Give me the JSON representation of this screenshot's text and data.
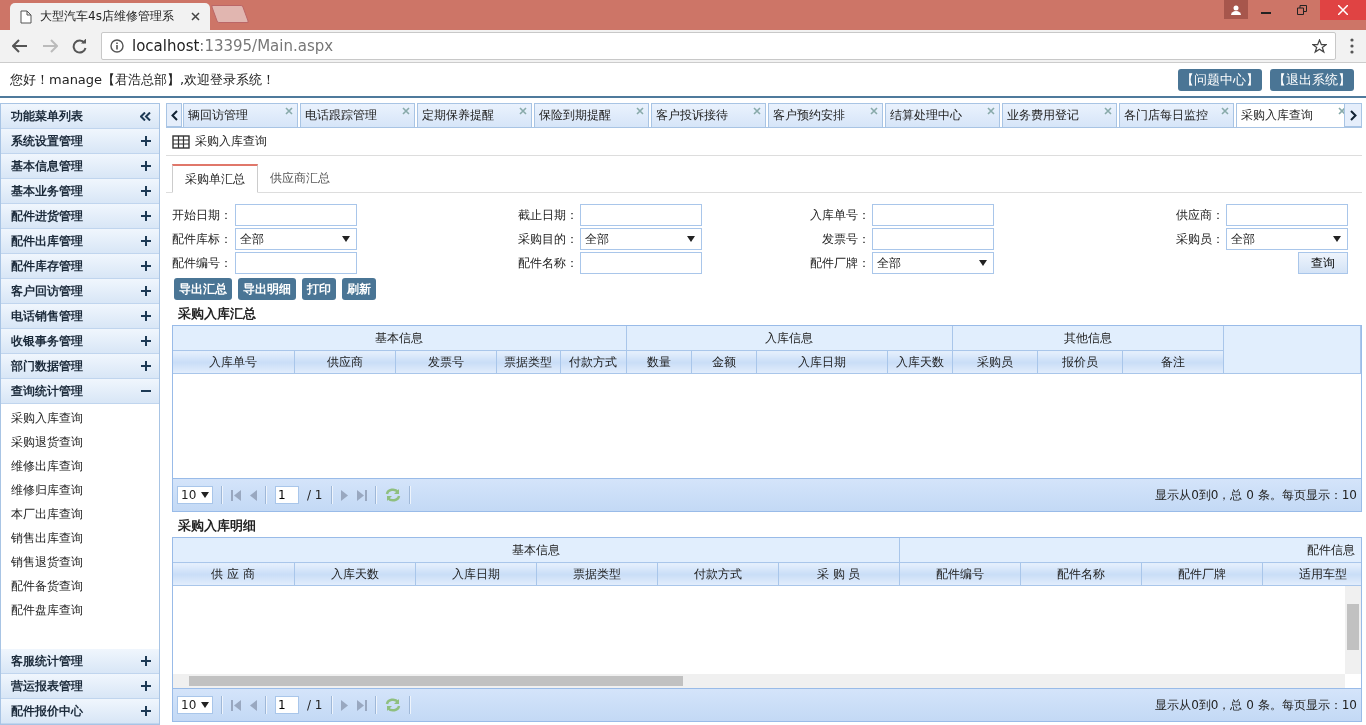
{
  "browser": {
    "tab_title": "大型汽车4s店维修管理系",
    "address_host": "localhost",
    "address_rest": ":13395/Main.aspx"
  },
  "header": {
    "greeting": "您好！manage【君浩总部】,欢迎登录系统！",
    "buttons": [
      "【问题中心】",
      "【退出系统】"
    ]
  },
  "sidebar": {
    "title": "功能菜单列表",
    "groups": [
      {
        "label": "系统设置管理",
        "expanded": false
      },
      {
        "label": "基本信息管理",
        "expanded": false
      },
      {
        "label": "基本业务管理",
        "expanded": false
      },
      {
        "label": "配件进货管理",
        "expanded": false
      },
      {
        "label": "配件出库管理",
        "expanded": false
      },
      {
        "label": "配件库存管理",
        "expanded": false
      },
      {
        "label": "客户回访管理",
        "expanded": false
      },
      {
        "label": "电话销售管理",
        "expanded": false
      },
      {
        "label": "收银事务管理",
        "expanded": false
      },
      {
        "label": "部门数据管理",
        "expanded": false
      },
      {
        "label": "查询统计管理",
        "expanded": true,
        "children": [
          "采购入库查询",
          "采购退货查询",
          "维修出库查询",
          "维修归库查询",
          "本厂出库查询",
          "销售出库查询",
          "销售退货查询",
          "配件备货查询",
          "配件盘库查询"
        ]
      },
      {
        "label": "客服统计管理",
        "expanded": false
      },
      {
        "label": "营运报表管理",
        "expanded": false
      },
      {
        "label": "配件报价中心",
        "expanded": false
      }
    ]
  },
  "tabs": [
    {
      "label": "辆回访管理",
      "selected": false
    },
    {
      "label": "电话跟踪管理",
      "selected": false
    },
    {
      "label": "定期保养提醒",
      "selected": false
    },
    {
      "label": "保险到期提醒",
      "selected": false
    },
    {
      "label": "客户投诉接待",
      "selected": false
    },
    {
      "label": "客户预约安排",
      "selected": false
    },
    {
      "label": "结算处理中心",
      "selected": false
    },
    {
      "label": "业务费用登记",
      "selected": false
    },
    {
      "label": "各门店每日监控",
      "selected": false
    },
    {
      "label": "采购入库查询",
      "selected": true
    }
  ],
  "page_title": "采购入库查询",
  "sub_tabs": [
    {
      "label": "采购单汇总",
      "selected": true
    },
    {
      "label": "供应商汇总",
      "selected": false
    }
  ],
  "filters": [
    {
      "label": "开始日期：",
      "kind": "input"
    },
    {
      "label": "截止日期：",
      "kind": "input"
    },
    {
      "label": "入库单号：",
      "kind": "input"
    },
    {
      "label": "供应商：",
      "kind": "input"
    },
    {
      "label": "配件库标：",
      "kind": "select",
      "value": "全部"
    },
    {
      "label": "采购目的：",
      "kind": "select",
      "value": "全部"
    },
    {
      "label": "发票号：",
      "kind": "input"
    },
    {
      "label": "采购员：",
      "kind": "select",
      "value": "全部"
    },
    {
      "label": "配件编号：",
      "kind": "input"
    },
    {
      "label": "配件名称：",
      "kind": "input"
    },
    {
      "label": "配件厂牌：",
      "kind": "select",
      "value": "全部"
    }
  ],
  "query_button": "查询",
  "actions": [
    "导出汇总",
    "导出明细",
    "打印",
    "刷新"
  ],
  "grids": [
    {
      "title": "采购入库汇总",
      "groups": [
        {
          "label": "基本信息"
        },
        {
          "label": "入库信息"
        },
        {
          "label": "其他信息"
        }
      ],
      "columns": [
        "入库单号",
        "供应商",
        "发票号",
        "票据类型",
        "付款方式",
        "数量",
        "金额",
        "入库日期",
        "入库天数",
        "采购员",
        "报价员",
        "备注"
      ],
      "pager": {
        "page_size": "10",
        "page": "1",
        "pages": "/ 1",
        "info": "显示从0到0，总 0 条。每页显示：10"
      }
    },
    {
      "title": "采购入库明细",
      "groups": [
        {
          "label": "基本信息"
        },
        {
          "label": "配件信息"
        }
      ],
      "columns": [
        "供 应 商",
        "入库天数",
        "入库日期",
        "票据类型",
        "付款方式",
        "采 购 员",
        "配件编号",
        "配件名称",
        "配件厂牌",
        "适用车型"
      ],
      "pager": {
        "page_size": "10",
        "page": "1",
        "pages": "/ 1",
        "info": "显示从0到0，总 0 条。每页显示：10"
      }
    }
  ]
}
